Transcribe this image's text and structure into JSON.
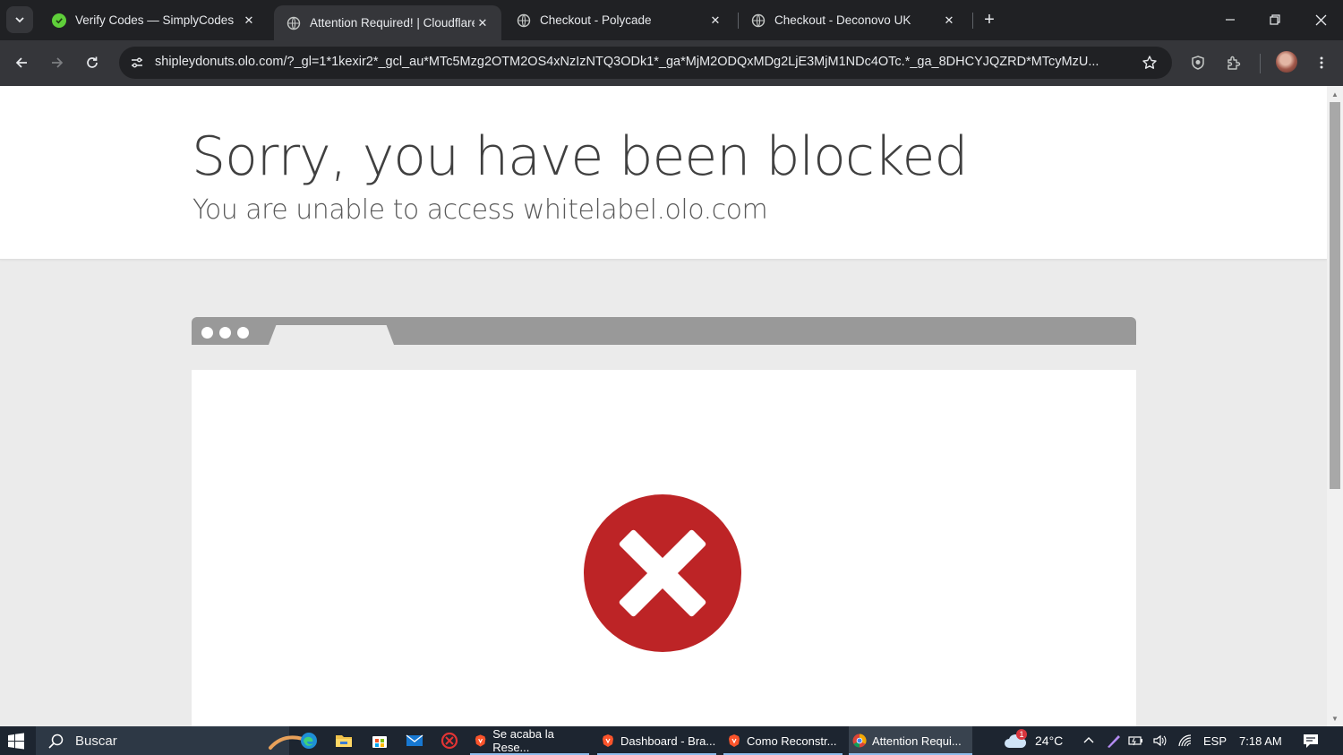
{
  "tabs": [
    {
      "title": "Verify Codes — SimplyCodes",
      "active": false
    },
    {
      "title": "Attention Required! | Cloudflare",
      "active": true
    },
    {
      "title": "Checkout - Polycade",
      "active": false
    },
    {
      "title": "Checkout - Deconovo UK",
      "active": false
    }
  ],
  "toolbar": {
    "url": "shipleydonuts.olo.com/?_gl=1*1kexir2*_gcl_au*MTc5Mzg2OTM2OS4xNzIzNTQ3ODk1*_ga*MjM2ODQxMDg2LjE3MjM1NDc4OTc.*_ga_8DHCYJQZRD*MTcyMzU..."
  },
  "page": {
    "heading": "Sorry, you have been blocked",
    "subheading": "You are unable to access whitelabel.olo.com"
  },
  "colors": {
    "error_red": "#bd2426",
    "mock_bar": "#999999"
  },
  "taskbar": {
    "search_placeholder": "Buscar",
    "tasks": [
      {
        "label": "Se acaba la Rese..."
      },
      {
        "label": "Dashboard - Bra..."
      },
      {
        "label": "Como Reconstr..."
      },
      {
        "label": "Attention Requi..."
      }
    ],
    "weather_temp": "24°C",
    "weather_badge": "1",
    "language": "ESP",
    "time": "7:18 AM"
  }
}
